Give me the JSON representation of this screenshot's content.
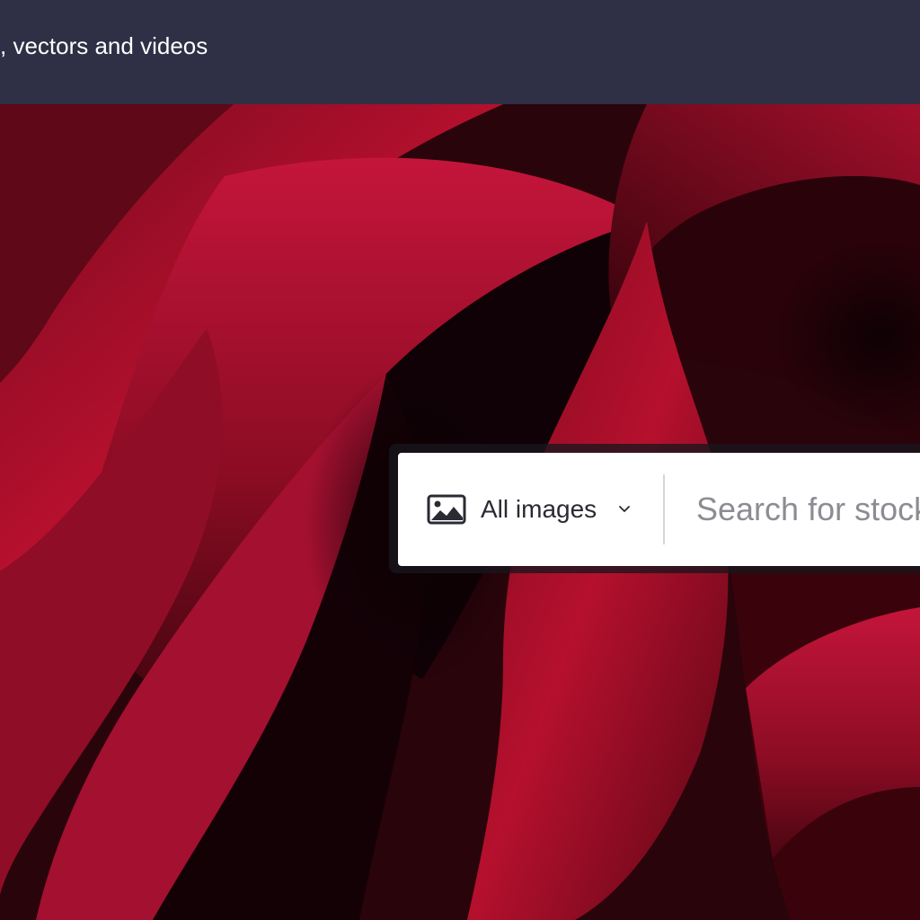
{
  "header": {
    "tagline": ", vectors and videos"
  },
  "hero": {
    "image": "red-rose-petals-closeup"
  },
  "search": {
    "type_selector": {
      "icon": "image-icon",
      "selected_label": "All images",
      "chevron": "chevron-down-icon"
    },
    "input": {
      "placeholder": "Search for stock",
      "value": ""
    }
  },
  "colors": {
    "banner_background": "#2f2f45",
    "search_background": "#ffffff",
    "placeholder_text": "#8c8c93"
  }
}
